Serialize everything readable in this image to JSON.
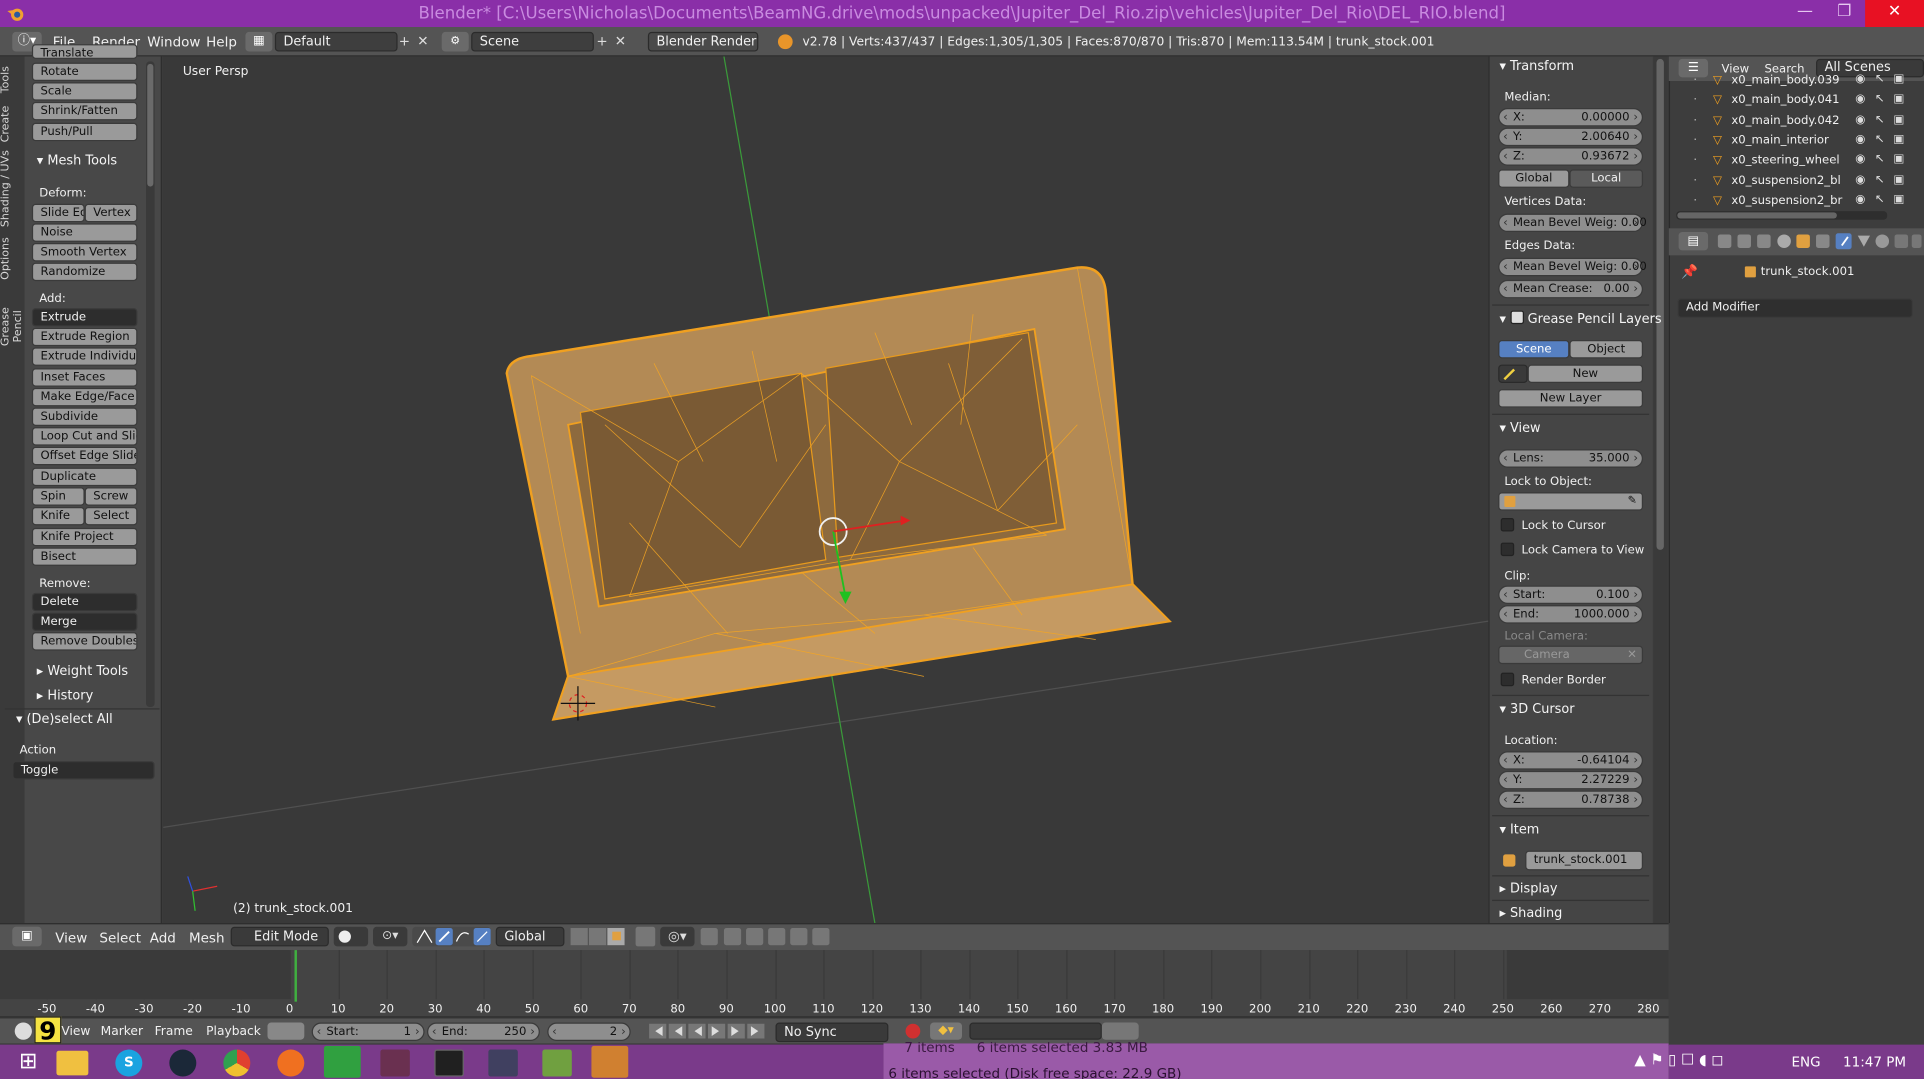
{
  "window": {
    "title": "Blender* [C:\\Users\\Nicholas\\Documents\\BeamNG.drive\\mods\\unpacked\\Jupiter_Del_Rio.zip\\vehicles\\Jupiter_Del_Rio\\DEL_RIO.blend]",
    "minimize": "—",
    "restore": "❐",
    "close": "✕"
  },
  "info_header": {
    "menus": [
      "File",
      "Render",
      "Window",
      "Help"
    ],
    "layout": "Default",
    "scene": "Scene",
    "engine": "Blender Render",
    "stats": "v2.78 | Verts:437/437 | Edges:1,305/1,305 | Faces:870/870 | Tris:870 | Mem:113.54M | trunk_stock.001"
  },
  "toolshelf": {
    "tabs": [
      "Tools",
      "Create",
      "Shading / UVs",
      "Options",
      "Grease Pencil"
    ],
    "transform_buttons": [
      "Translate",
      "Rotate",
      "Scale",
      "Shrink/Fatten",
      "Push/Pull"
    ],
    "mesh_tools_title": "Mesh Tools",
    "deform_label": "Deform:",
    "slide_edge": "Slide Ed",
    "vertex": "Vertex",
    "noise": "Noise",
    "smooth_vertex": "Smooth Vertex",
    "randomize": "Randomize",
    "add_label": "Add:",
    "extrude": "Extrude",
    "add_buttons": [
      "Extrude Region",
      "Extrude Individual",
      "Inset Faces",
      "Make Edge/Face",
      "Subdivide",
      "Loop Cut and Slide",
      "Offset Edge Slide",
      "Duplicate"
    ],
    "spin": "Spin",
    "screw": "Screw",
    "knife": "Knife",
    "select": "Select",
    "knife_project": "Knife Project",
    "bisect": "Bisect",
    "remove_label": "Remove:",
    "delete": "Delete",
    "merge": "Merge",
    "remove_doubles": "Remove Doubles",
    "weight_tools": "Weight Tools",
    "history": "History",
    "operator_title": "(De)select All",
    "action_label": "Action",
    "action_value": "Toggle"
  },
  "viewport": {
    "view_name": "User Persp",
    "object_label": "(2) trunk_stock.001"
  },
  "properties": {
    "transform_title": "Transform",
    "median_label": "Median:",
    "median": [
      {
        "k": "X:",
        "v": "0.00000"
      },
      {
        "k": "Y:",
        "v": "2.00640"
      },
      {
        "k": "Z:",
        "v": "0.93672"
      }
    ],
    "global": "Global",
    "local": "Local",
    "vertices_data": "Vertices Data:",
    "mean_bevel_v": "Mean Bevel Weig: 0.00",
    "edges_data": "Edges Data:",
    "mean_bevel_e": "Mean Bevel Weig: 0.00",
    "mean_crease_k": "Mean Crease:",
    "mean_crease_v": "0.00",
    "gp_title": "Grease Pencil Layers",
    "scene": "Scene",
    "object": "Object",
    "new": "New",
    "new_layer": "New Layer",
    "view_title": "View",
    "lens_k": "Lens:",
    "lens_v": "35.000",
    "lock_to_object": "Lock to Object:",
    "lock_to_cursor": "Lock to Cursor",
    "lock_camera": "Lock Camera to View",
    "clip_label": "Clip:",
    "clip_start_k": "Start:",
    "clip_start_v": "0.100",
    "clip_end_k": "End:",
    "clip_end_v": "1000.000",
    "local_camera": "Local Camera:",
    "camera": "Camera",
    "render_border": "Render Border",
    "cursor_title": "3D Cursor",
    "location_label": "Location:",
    "cursor": [
      {
        "k": "X:",
        "v": "-0.64104"
      },
      {
        "k": "Y:",
        "v": "2.27229"
      },
      {
        "k": "Z:",
        "v": "0.78738"
      }
    ],
    "item_title": "Item",
    "item_name": "trunk_stock.001",
    "display_title": "Display",
    "shading_title": "Shading"
  },
  "outliner": {
    "view": "View",
    "search": "Search",
    "scenes": "All Scenes",
    "rows": [
      "x0_main_body.039",
      "x0_main_body.041",
      "x0_main_body.042",
      "x0_main_interior",
      "x0_steering_wheel",
      "x0_suspension2_bl",
      "x0_suspension2_br"
    ]
  },
  "modifiers": {
    "object": "trunk_stock.001",
    "add_modifier": "Add Modifier"
  },
  "view3d_header": {
    "menus": [
      "View",
      "Select",
      "Add",
      "Mesh"
    ],
    "mode": "Edit Mode",
    "orientation": "Global"
  },
  "timeline": {
    "ticks": [
      "-50",
      "-40",
      "-30",
      "-20",
      "-10",
      "0",
      "10",
      "20",
      "30",
      "40",
      "50",
      "60",
      "70",
      "80",
      "90",
      "100",
      "110",
      "120",
      "130",
      "140",
      "150",
      "160",
      "170",
      "180",
      "190",
      "200",
      "210",
      "220",
      "230",
      "240",
      "250",
      "260",
      "270",
      "280"
    ],
    "menus": [
      "View",
      "Marker",
      "Frame",
      "Playback"
    ],
    "start_k": "Start:",
    "start_v": "1",
    "end_k": "End:",
    "end_v": "250",
    "current": "2",
    "sync": "No Sync",
    "frame_badge": "9"
  },
  "explorer_status": {
    "items": "7 items",
    "selected": "6 items selected  3.83 MB",
    "disk": "6 items selected (Disk free space: 22.9 GB)"
  },
  "taskbar": {
    "lang": "ENG",
    "time": "11:47 PM"
  }
}
